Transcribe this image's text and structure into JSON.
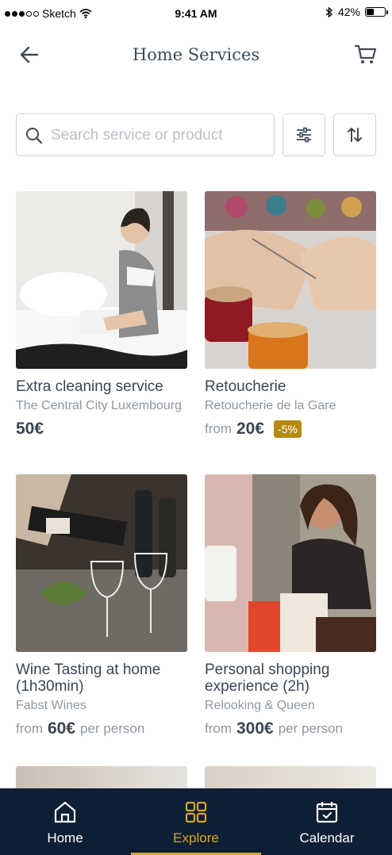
{
  "status_bar": {
    "carrier": "Sketch",
    "time": "9:41 AM",
    "battery": "42%",
    "battery_level": 0.42
  },
  "header": {
    "title": "Home Services"
  },
  "search": {
    "placeholder": "Search service or product"
  },
  "cards": [
    {
      "name": "Extra cleaning service",
      "provider": "The Central City Luxembourg",
      "price_prefix": "",
      "price": "50€",
      "price_suffix": "",
      "badge": ""
    },
    {
      "name": "Retoucherie",
      "provider": "Retoucherie de la Gare",
      "price_prefix": "from",
      "price": "20€",
      "price_suffix": "",
      "badge": "-5%"
    },
    {
      "name": "Wine Tasting at home (1h30min)",
      "provider": "Fabst Wines",
      "price_prefix": "from",
      "price": "60€",
      "price_suffix": "per person",
      "badge": ""
    },
    {
      "name": "Personal shopping experience (2h)",
      "provider": "Relooking & Queen",
      "price_prefix": "from",
      "price": "300€",
      "price_suffix": "per person",
      "badge": ""
    }
  ],
  "tabbar": {
    "items": [
      {
        "label": "Home",
        "icon": "home-icon"
      },
      {
        "label": "Explore",
        "icon": "grid-icon"
      },
      {
        "label": "Calendar",
        "icon": "calendar-icon"
      }
    ],
    "active": "Explore"
  },
  "colors": {
    "accent": "#d6a62a",
    "tabbar_bg": "#0e1e34",
    "badge_bg": "#b58b12"
  }
}
